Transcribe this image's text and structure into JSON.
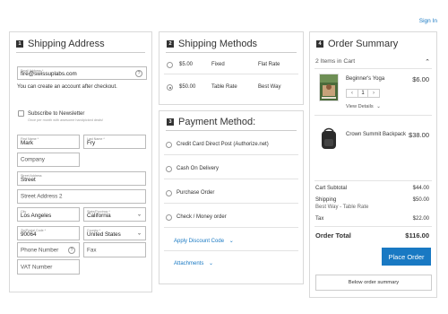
{
  "header": {
    "signin": "Sign In"
  },
  "shipping": {
    "step": "1",
    "title": "Shipping Address",
    "email": {
      "label": "Email Address *",
      "value": "fire@swissuplabs.com"
    },
    "create_account_note": "You can create an account after checkout.",
    "newsletter_label": "Subscribe to Newsletter",
    "newsletter_note": "Once per month with awesome handpicked deals!",
    "first_name": {
      "label": "First Name *",
      "value": "Mark"
    },
    "last_name": {
      "label": "Last Name *",
      "value": "Fry"
    },
    "company_placeholder": "Company",
    "street": {
      "label": "Street Address",
      "value": "Street"
    },
    "street2_placeholder": "Street Address 2",
    "city": {
      "label": "City",
      "value": "Los Angeles"
    },
    "state": {
      "label": "State/Province *",
      "value": "California"
    },
    "zip": {
      "label": "Zip/Postal Code *",
      "value": "90064"
    },
    "country": {
      "label": "Country *",
      "value": "United States"
    },
    "phone_placeholder": "Phone Number",
    "fax_placeholder": "Fax",
    "vat_placeholder": "VAT Number"
  },
  "methods": {
    "step": "2",
    "title": "Shipping Methods",
    "rows": [
      {
        "price": "$5.00",
        "method": "Fixed",
        "carrier": "Flat Rate",
        "selected": false
      },
      {
        "price": "$50.00",
        "method": "Table Rate",
        "carrier": "Best Way",
        "selected": true
      }
    ]
  },
  "payment": {
    "step": "3",
    "title": "Payment Method:",
    "options": [
      "Credit Card Direct Post (Authorize.net)",
      "Cash On Delivery",
      "Purchase Order",
      "Check / Money order"
    ],
    "discount_link": "Apply Discount Code",
    "attachments_link": "Attachments"
  },
  "summary": {
    "step": "4",
    "title": "Order Summary",
    "items_count": "2 Items in Cart",
    "items": [
      {
        "name": "Beginner's Yoga",
        "price": "$6.00",
        "qty": "1",
        "details": "View Details"
      },
      {
        "name": "Crown Summit Backpack",
        "price": "$38.00"
      }
    ],
    "totals": {
      "subtotal_label": "Cart Subtotal",
      "subtotal": "$44.00",
      "shipping_label": "Shipping",
      "shipping": "$50.00",
      "shipping_sub": "Best Way - Table Rate",
      "tax_label": "Tax",
      "tax": "$22.00",
      "order_total_label": "Order Total",
      "order_total": "$116.00"
    },
    "place_order": "Place Order",
    "below_order_summary": "Below order summary"
  },
  "colors": {
    "accent": "#1979c3",
    "badge": "#333333"
  }
}
